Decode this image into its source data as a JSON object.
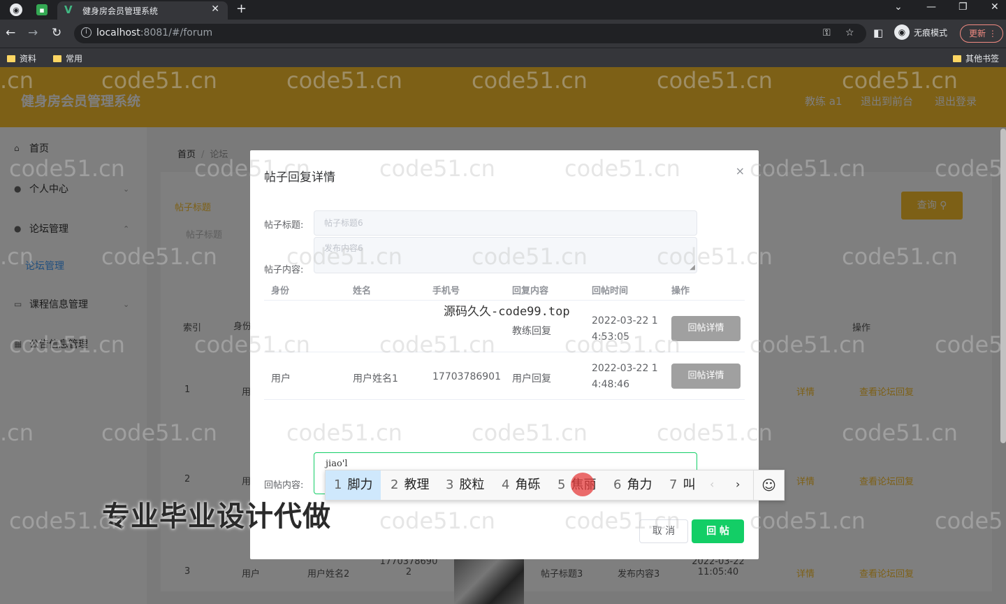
{
  "browser": {
    "tab_title": "健身房会员管理系统",
    "url_host": "localhost",
    "url_rest": ":8081/#/forum",
    "incognito_label": "无痕模式",
    "update_label": "更新",
    "bookmarks": [
      "资料",
      "常用"
    ],
    "other_bookmarks": "其他书签"
  },
  "app": {
    "title": "健身房会员管理系统",
    "header_links": [
      "教练 a1",
      "退出到前台",
      "退出登录"
    ],
    "sidebar": [
      {
        "label": "首页",
        "icon": "home-icon"
      },
      {
        "label": "个人中心",
        "icon": "user-icon"
      },
      {
        "label": "论坛管理",
        "icon": "user-icon"
      },
      {
        "label": "论坛管理",
        "icon": ""
      },
      {
        "label": "课程信息管理",
        "icon": "list-icon"
      },
      {
        "label": "公告信息管理",
        "icon": "notice-icon"
      }
    ],
    "breadcrumb": {
      "home": "首页",
      "current": "论坛"
    },
    "search_label": "帖子标题",
    "search_placeholder": "帖子标题",
    "search_button": "查询",
    "bg_headers": {
      "index": "索引",
      "identity": "身份",
      "ops": "操作"
    },
    "bg_rows": [
      {
        "index": "1",
        "identity": "用",
        "view": "详情",
        "replies": "查看论坛回复"
      },
      {
        "index": "2",
        "identity": "用",
        "view": "详情",
        "replies": "查看论坛回复"
      },
      {
        "index": "3",
        "identity": "用户",
        "name": "用户姓名2",
        "phone": "17703786902",
        "title": "帖子标题3",
        "content": "发布内容3",
        "time": "2022-03-22 11:05:40",
        "view": "详情",
        "replies": "查看论坛回复"
      }
    ]
  },
  "dialog": {
    "title": "帖子回复详情",
    "post_title_label": "帖子标题:",
    "post_title_value": "帖子标题6",
    "post_content_label": "帖子内容:",
    "post_content_value": "发布内容6",
    "columns": [
      "身份",
      "姓名",
      "手机号",
      "回复内容",
      "回帖时间",
      "操作"
    ],
    "rows": [
      {
        "identity": "",
        "name": "",
        "phone": "",
        "reply": "教练回复",
        "time1": "2022-03-22 1",
        "time2": "4:53:05",
        "action": "回帖详情"
      },
      {
        "identity": "用户",
        "name": "用户姓名1",
        "phone": "17703786901",
        "reply": "用户回复",
        "time1": "2022-03-22 1",
        "time2": "4:48:46",
        "action": "回帖详情"
      }
    ],
    "reply_label": "回帖内容:",
    "reply_typed": "jiao'l",
    "cancel_button": "取 消",
    "submit_button": "回 帖",
    "overlay_text": "源码久久-code99.top"
  },
  "ime": {
    "candidates": [
      {
        "num": "1",
        "text": "脚力"
      },
      {
        "num": "2",
        "text": "教理"
      },
      {
        "num": "3",
        "text": "胶粒"
      },
      {
        "num": "4",
        "text": "角砾"
      },
      {
        "num": "5",
        "text": "焦丽"
      },
      {
        "num": "6",
        "text": "角力"
      },
      {
        "num": "7",
        "text": "叫"
      }
    ]
  },
  "promo_text": "专业毕业设计代做",
  "watermark": "code51.cn"
}
